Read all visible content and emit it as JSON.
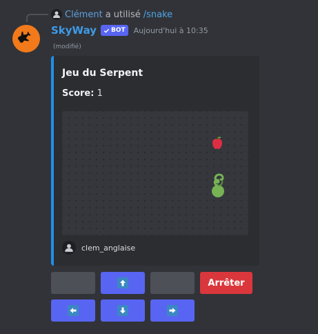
{
  "reply": {
    "user": "Clément",
    "verb": "a utilisé",
    "command": "/snake"
  },
  "message": {
    "author": "SkyWay",
    "badge": "BOT",
    "timestamp": "Aujourd'hui à 10:35",
    "edited": "(modifié)"
  },
  "embed": {
    "accent_color": "#1e90e8",
    "title": "Jeu du Serpent",
    "score_label": "Score:",
    "score_value": "1",
    "footer_user": "clem_anglaise"
  },
  "controls": {
    "row1": [
      "",
      "up-arrow",
      "",
      "Arrêter"
    ],
    "row2": [
      "left-arrow",
      "down-arrow",
      "right-arrow"
    ],
    "stop_label": "Arrêter",
    "stop_color": "#da373c",
    "button_color": "#5865f2",
    "disabled_color": "#4e5058"
  }
}
